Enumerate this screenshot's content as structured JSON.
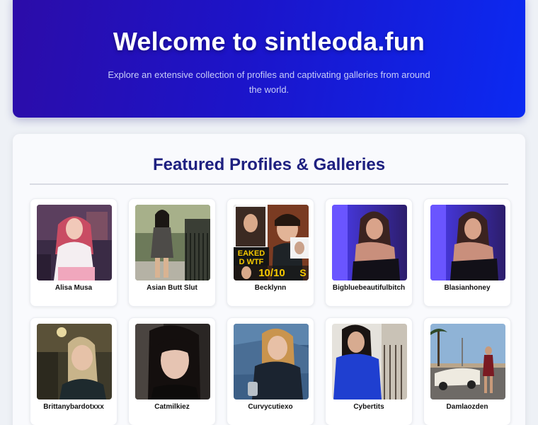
{
  "hero": {
    "title": "Welcome to sintleoda.fun",
    "subtitle": "Explore an extensive collection of profiles and captivating galleries from around the world."
  },
  "section": {
    "title": "Featured Profiles & Galleries"
  },
  "profiles": [
    {
      "name": "Alisa Musa",
      "thumb_overlay": ""
    },
    {
      "name": "Asian Butt Slut",
      "thumb_overlay": ""
    },
    {
      "name": "Becklynn",
      "thumb_overlay": "EAKED D WTF 10/10 S"
    },
    {
      "name": "Bigbluebeautifulbitch",
      "thumb_overlay": ""
    },
    {
      "name": "Blasianhoney",
      "thumb_overlay": ""
    },
    {
      "name": "Brittanybardotxxx",
      "thumb_overlay": ""
    },
    {
      "name": "Catmilkiez",
      "thumb_overlay": ""
    },
    {
      "name": "Curvycutiexo",
      "thumb_overlay": ""
    },
    {
      "name": "Cybertits",
      "thumb_overlay": ""
    },
    {
      "name": "Damlaozden",
      "thumb_overlay": ""
    }
  ],
  "colors": {
    "hero_gradient_start": "#2c0ca8",
    "hero_gradient_end": "#0b2af2",
    "section_title": "#1e2080"
  }
}
